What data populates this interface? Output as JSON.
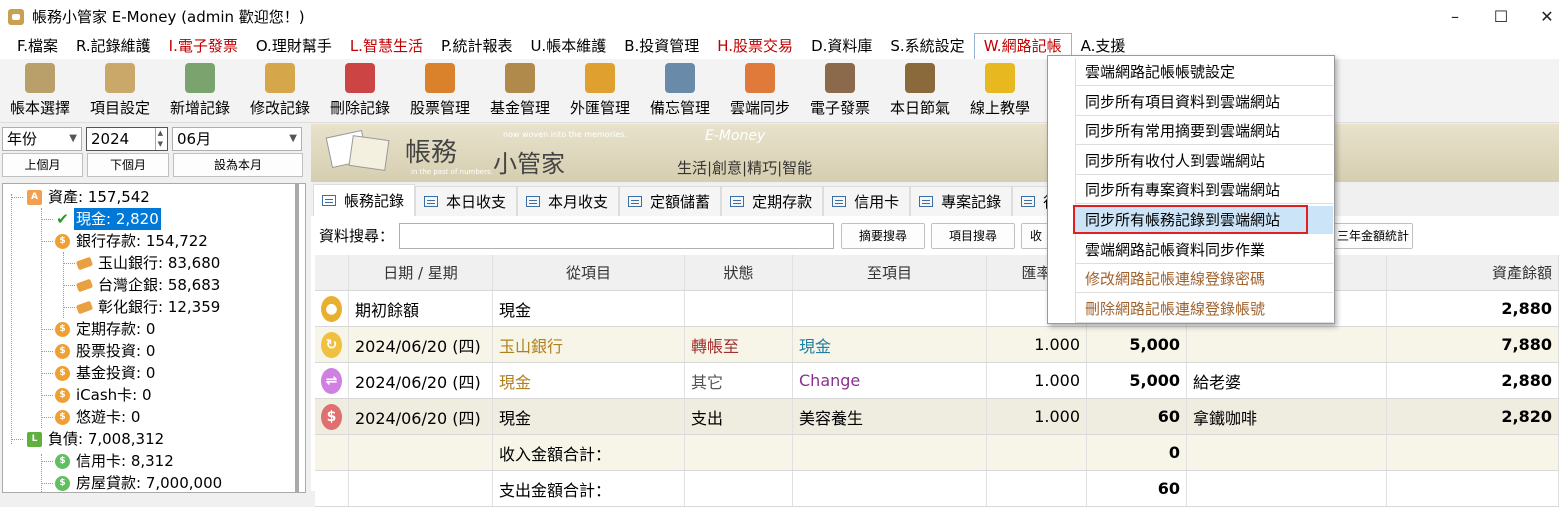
{
  "window": {
    "title": "帳務小管家 E-Money (admin 歡迎您！)",
    "minimize": "–",
    "maximize": "☐",
    "close": "✕"
  },
  "menu": [
    {
      "label": "F.檔案",
      "color": "normal"
    },
    {
      "label": "R.記錄維護",
      "color": "normal"
    },
    {
      "label": "I.電子發票",
      "color": "red"
    },
    {
      "label": "O.理財幫手",
      "color": "normal"
    },
    {
      "label": "L.智慧生活",
      "color": "red"
    },
    {
      "label": "P.統計報表",
      "color": "normal"
    },
    {
      "label": "U.帳本維護",
      "color": "normal"
    },
    {
      "label": "B.投資管理",
      "color": "normal"
    },
    {
      "label": "H.股票交易",
      "color": "red"
    },
    {
      "label": "D.資料庫",
      "color": "normal"
    },
    {
      "label": "S.系統設定",
      "color": "normal"
    },
    {
      "label": "W.網路記帳",
      "color": "active"
    },
    {
      "label": "A.支援",
      "color": "normal"
    }
  ],
  "toolbar": [
    {
      "label": "帳本選擇",
      "icon": "ledger-icon",
      "color": "#b9a06a"
    },
    {
      "label": "項目設定",
      "icon": "settings-doc-icon",
      "color": "#c9a86a"
    },
    {
      "label": "新增記錄",
      "icon": "add-doc-icon",
      "color": "#7aa36e"
    },
    {
      "label": "修改記錄",
      "icon": "edit-doc-icon",
      "color": "#d6a64a"
    },
    {
      "label": "刪除記錄",
      "icon": "delete-doc-icon",
      "color": "#c44"
    },
    {
      "label": "股票管理",
      "icon": "stock-icon",
      "color": "#d9822b"
    },
    {
      "label": "基金管理",
      "icon": "fund-icon",
      "color": "#b08a4a"
    },
    {
      "label": "外匯管理",
      "icon": "forex-icon",
      "color": "#e0a030"
    },
    {
      "label": "備忘管理",
      "icon": "memo-icon",
      "color": "#6a8aaa"
    },
    {
      "label": "雲端同步",
      "icon": "cloud-sync-icon",
      "color": "#e07a3a"
    },
    {
      "label": "電子發票",
      "icon": "qr-invoice-icon",
      "color": "#8a6a4a"
    },
    {
      "label": "本日節氣",
      "icon": "solar-term-icon",
      "color": "#8a6a3a"
    },
    {
      "label": "線上教學",
      "icon": "help-icon",
      "color": "#e8b820"
    }
  ],
  "period": {
    "year_label": "年份",
    "year": "2024",
    "month": "06月",
    "prev_btn": "上個月",
    "next_btn": "下個月",
    "set_btn": "設為本月"
  },
  "tree": [
    {
      "label": "資產: 157,542",
      "icon": "asset-icon",
      "iconText": "A",
      "color": "#f0a050",
      "level": 0
    },
    {
      "label": "現金: 2,820",
      "icon": "check-icon",
      "iconText": "✔",
      "color": "#22a020",
      "level": 1,
      "selected": true
    },
    {
      "label": "銀行存款: 154,722",
      "icon": "coin-icon",
      "iconText": "$",
      "color": "#f0a030",
      "level": 1
    },
    {
      "label": "玉山銀行: 83,680",
      "icon": "card-icon",
      "iconText": "",
      "color": "#e8a040",
      "level": 2
    },
    {
      "label": "台灣企銀: 58,683",
      "icon": "card-icon",
      "iconText": "",
      "color": "#e8a040",
      "level": 2
    },
    {
      "label": "彰化銀行: 12,359",
      "icon": "card-icon",
      "iconText": "",
      "color": "#e8a040",
      "level": 2
    },
    {
      "label": "定期存款: 0",
      "icon": "coin-icon",
      "iconText": "$",
      "color": "#f0a030",
      "level": 1
    },
    {
      "label": "股票投資: 0",
      "icon": "coin-icon",
      "iconText": "$",
      "color": "#f0a030",
      "level": 1
    },
    {
      "label": "基金投資: 0",
      "icon": "coin-icon",
      "iconText": "$",
      "color": "#f0a030",
      "level": 1
    },
    {
      "label": "iCash卡: 0",
      "icon": "coin-icon",
      "iconText": "$",
      "color": "#f0a030",
      "level": 1
    },
    {
      "label": "悠遊卡: 0",
      "icon": "coin-icon",
      "iconText": "$",
      "color": "#f0a030",
      "level": 1
    },
    {
      "label": "負債: 7,008,312",
      "icon": "liability-icon",
      "iconText": "L",
      "color": "#60b040",
      "level": 0
    },
    {
      "label": "信用卡: 8,312",
      "icon": "coin-icon",
      "iconText": "$",
      "color": "#60c060",
      "level": 1
    },
    {
      "label": "房屋貸款: 7,000,000",
      "icon": "coin-icon",
      "iconText": "$",
      "color": "#60c060",
      "level": 1
    }
  ],
  "banner": {
    "title1": "帳務",
    "title2": "小管家",
    "tag1": "now woven into the memories.",
    "tag2": "in the past of numbers.",
    "brand": "E-Money",
    "motto": "生活|創意|精巧|智能"
  },
  "tabs": [
    "帳務記錄",
    "本日收支",
    "本月收支",
    "定額儲蓄",
    "定期存款",
    "信用卡",
    "專案記錄",
    "行"
  ],
  "search": {
    "label": "資料搜尋：",
    "value": "",
    "summary_btn": "摘要搜尋",
    "item_btn": "項目搜尋",
    "partial_btn": "收",
    "stats_btn": "三年金額統計"
  },
  "grid": {
    "headers": [
      "日期 / 星期",
      "從項目",
      "狀態",
      "至項目",
      "匯率",
      "",
      "",
      "資產餘額"
    ],
    "rows": [
      {
        "icon": "money-bag-icon",
        "iconColor": "#e8b030",
        "date": "期初餘額",
        "from": "現金",
        "fromColor": "#000",
        "status": "",
        "statusColor": "#000",
        "to": "",
        "toColor": "#000",
        "rate": "",
        "amount": "",
        "memo": "",
        "balance": "2,880",
        "bg": "#fff"
      },
      {
        "icon": "transfer-icon",
        "iconColor": "#f0c040",
        "date": "2024/06/20 (四)",
        "from": "玉山銀行",
        "fromColor": "#b08020",
        "status": "轉帳至",
        "statusColor": "#a03030",
        "to": "現金",
        "toColor": "#2080a0",
        "rate": "1.000",
        "amount": "5,000",
        "memo": "",
        "balance": "7,880",
        "bg": "#f7f5e8"
      },
      {
        "icon": "exchange-icon",
        "iconColor": "#d080e0",
        "date": "2024/06/20 (四)",
        "from": "現金",
        "fromColor": "#b08020",
        "status": "其它",
        "statusColor": "#555",
        "to": "Change",
        "toColor": "#8a3090",
        "rate": "1.000",
        "amount": "5,000",
        "memo": "給老婆",
        "balance": "2,880",
        "bg": "#fff"
      },
      {
        "icon": "expense-icon",
        "iconColor": "#e07070",
        "date": "2024/06/20 (四)",
        "from": "現金",
        "fromColor": "#000",
        "status": "支出",
        "statusColor": "#000",
        "to": "美容養生",
        "toColor": "#000",
        "rate": "1.000",
        "amount": "60",
        "memo": "拿鐵咖啡",
        "balance": "2,820",
        "bg": "#efece0"
      },
      {
        "icon": "",
        "iconColor": "",
        "date": "",
        "from": "收入金額合計：",
        "fromColor": "#000",
        "status": "",
        "statusColor": "#000",
        "to": "",
        "toColor": "#000",
        "rate": "",
        "amount": "0",
        "memo": "",
        "balance": "",
        "bg": "#f7f5e8"
      },
      {
        "icon": "",
        "iconColor": "",
        "date": "",
        "from": "支出金額合計：",
        "fromColor": "#000",
        "status": "",
        "statusColor": "#000",
        "to": "",
        "toColor": "#000",
        "rate": "",
        "amount": "60",
        "memo": "",
        "balance": "",
        "bg": "#fff"
      }
    ]
  },
  "dropdown": [
    {
      "label": "雲端網路記帳帳號設定",
      "style": "normal"
    },
    {
      "label": "同步所有項目資料到雲端網站",
      "style": "normal"
    },
    {
      "label": "同步所有常用摘要到雲端網站",
      "style": "normal"
    },
    {
      "label": "同步所有收付人到雲端網站",
      "style": "normal"
    },
    {
      "label": "同步所有專案資料到雲端網站",
      "style": "normal"
    },
    {
      "label": "同步所有帳務記錄到雲端網站",
      "style": "highlight"
    },
    {
      "label": "雲端網路記帳資料同步作業",
      "style": "normal"
    },
    {
      "label": "修改網路記帳連線登錄密碼",
      "style": "brown"
    },
    {
      "label": "刪除網路記帳連線登錄帳號",
      "style": "brown"
    }
  ]
}
